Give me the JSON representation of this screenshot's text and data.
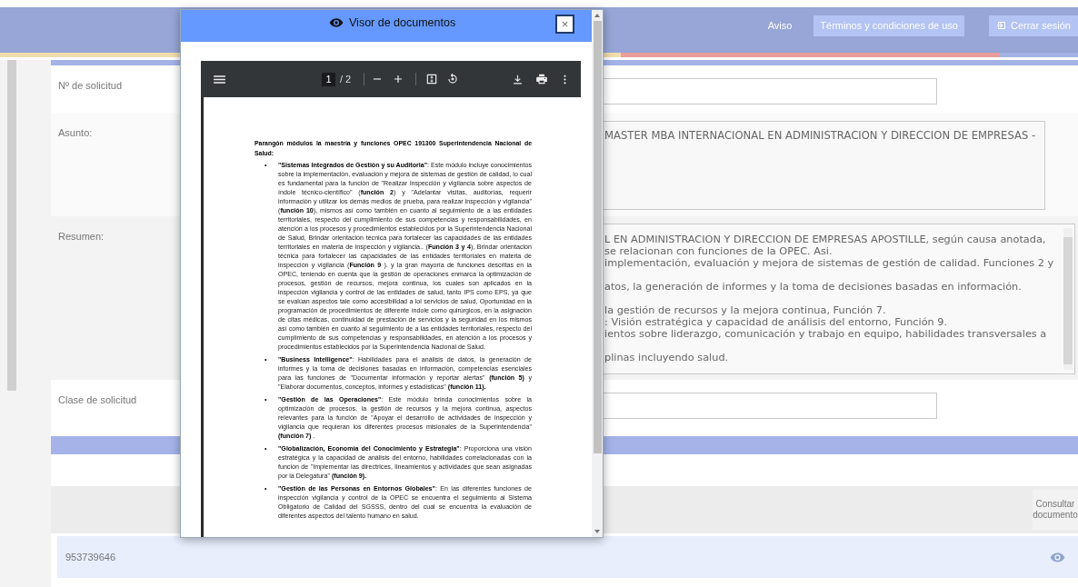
{
  "header": {
    "items": [
      {
        "kind": "link",
        "label": "Aviso"
      },
      {
        "kind": "button",
        "label": "Términos y condiciones de uso"
      },
      {
        "kind": "icon-button",
        "label": "Cerrar sesión"
      }
    ]
  },
  "form": {
    "fields": [
      {
        "kind": "input",
        "label": "Nº de solicitud"
      },
      {
        "kind": "textarea",
        "label": "Asunto:",
        "value": "MASTER MBA INTERNACIONAL EN ADMINISTRACION Y DIRECCION  DE EMPRESAS -"
      },
      {
        "kind": "scroll-textarea",
        "label": "Resumen:",
        "paragraphs": [
          [
            "L EN ADMINISTRACION Y DIRECCION DE EMPRESAS APOSTILLE, según causa anotada,",
            "se relacionan con funciones de la OPEC.  Asi.",
            "implementación, evaluación y mejora de sistemas de gestión de calidad. Funciones 2 y"
          ],
          [
            "atos, la generación de informes y la toma de decisiones basadas en información."
          ],
          [
            "la gestión de recursos y la mejora continua, Función 7.",
            ": Visión estratégica y capacidad de análisis del entorno, Función 9.",
            "ientos sobre liderazgo, comunicación y trabajo en equipo, habilidades transversales a"
          ],
          [
            "plinas incluyendo salud."
          ]
        ]
      },
      {
        "kind": "input",
        "label": "Clase de solicitud"
      }
    ]
  },
  "table": {
    "columns": [
      {
        "label": "Consultar documento"
      }
    ],
    "rows": [
      {
        "number": "953739646"
      }
    ]
  },
  "viewer": {
    "title": "Visor de documentos",
    "close": "×",
    "page": "1",
    "page_total": "/ 2",
    "document": {
      "heading": "Parangón módulos la maestría y funciones OPEC 191300 Superintendencia Nacional  de Salud:",
      "marker": "•",
      "bullets": [
        "**\"Sistemas Integrados de Gestión y su Auditoria\"**: Este módulo incluye conocimientos sobre la implementación, evaluación y mejora de sistemas de gestión de calidad, lo cual es fundamental para la función de \"Realizar inspección y vigilancia sobre aspectos de índole técnico-científico\" (**función 2**) y \"Adelantar visitas, auditorías, requerir información y utilizar los demás medios de prueba, para realizar inspección y vigilancia\" (**función 10**),  mismos así como también en cuanto al seguimiento de a las entidades territoriales, respecto del cumplimiento de sus competencias y responsabilidades, en atención a los procesos y procedimientos establecidos por la Superintendencia Nacional de Salud, Brindar orientación técnica para fortalecer las capacidades de las entidades territoriales en materia de inspección y vigilancia.. (**Función 3 y 4**), Brindar orientación técnica para fortalecer las capacidades de las entidades territoriales en materia de inspección y vigilancia (**Función 9** ).  y la gran mayoría de funciones descritas en la OPEC, teniendo en cuenta que la gestión de operaciones enmarca la optimización de procesos, gestión de recursos, mejora continua, los cuales son aplicados en la inspección vigilancia y control de las entidades de salud, tanto IPS como EPS, ya que se evalúan aspectos tale como accesibilidad a lol servicios de salud, Oportunidad en la programación de procedimientos de diferente índole como quirúrgicos, en la asignación de citas médicas, continuidad de prestación de servicios y la seguridad en los mismos así como también en cuanto al seguimiento de a las entidades territoriales, respecto del cumplimiento de sus competencias y responsabilidades, en atención a los procesos y procedimientos establecidos por la Superintendencia Nacional de Salud.",
        "**\"Business Intelligence\"**: Habilidades para el análisis de datos, la generación de informes y la toma de decisiones basadas en información, competencias esenciales para las funciones de \"Documentar información y reportar alertas\" **(función 5)** y \"Elaborar documentos, conceptos, informes y estadísticas\" **(función 11).**",
        "**\"Gestión de las Operaciones\"**: Este módulo brinda conocimientos sobre la optimización de procesos, la gestión de recursos y la mejora continua, aspectos relevantes para la función de \"Apoyar el desarrollo de actividades de inspección y vigilancia que requieran los diferentes procesos misionales de la Superintendencia\" **(función 7)** .",
        "**\"Globalización, Economía del Conocimiento y Estrategia\"**: Proporciona una visión estratégica y la capacidad de análisis del entorno, habilidades correlacionadas con la función de \"Implementar las directrices, lineamientos y actividades que sean asignadas por la Delegatura\" **(función 9).**",
        "**\"Gestión de las Personas en Entornos Globales\"**: En las diferentes funciones de inspección vigilancia y control de la OPEC se encuentra el seguimiento al Sistema Obligatorio de Calidad del SGSSS, dentro del cual se encuentra la evaluación de diferentes aspectos del talento humano en salud."
      ]
    }
  }
}
